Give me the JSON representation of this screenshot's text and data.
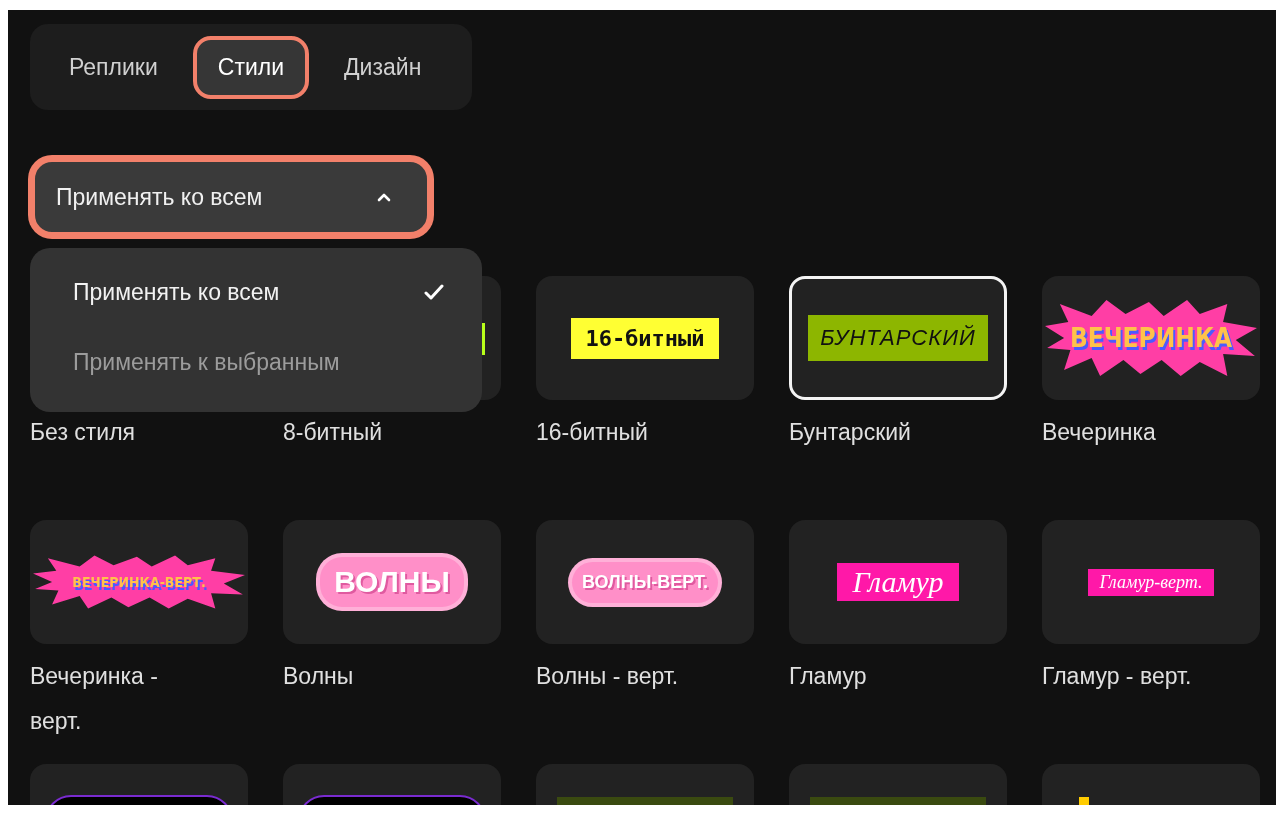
{
  "tabs": [
    {
      "label": "Реплики",
      "selected": false,
      "highlighted": false
    },
    {
      "label": "Стили",
      "selected": true,
      "highlighted": true
    },
    {
      "label": "Дизайн",
      "selected": false,
      "highlighted": false
    }
  ],
  "apply_dropdown": {
    "value": "Применять ко всем",
    "expanded": true,
    "highlighted": true,
    "options": [
      {
        "label": "Применять ко всем",
        "selected": true
      },
      {
        "label": "Применять к выбранным",
        "selected": false
      }
    ]
  },
  "styles": [
    {
      "label": "Без стиля",
      "preview": {
        "kind": "none"
      }
    },
    {
      "label": "8-битный",
      "selected": false,
      "preview": {
        "kind": "bar-edge"
      }
    },
    {
      "label": "16-битный",
      "selected": false,
      "preview": {
        "kind": "pixel",
        "text": "16-битный"
      }
    },
    {
      "label": "Бунтарский",
      "selected": true,
      "preview": {
        "kind": "grunge",
        "text": "БУНТАРСКИЙ"
      }
    },
    {
      "label": "Вечеринка",
      "selected": false,
      "preview": {
        "kind": "party",
        "text": "ВЕЧЕРИНКА",
        "small": false
      }
    },
    {
      "label": "Вечеринка - верт.",
      "selected": false,
      "preview": {
        "kind": "party",
        "text": "ВЕЧЕРИНКА-ВЕРТ.",
        "small": true
      }
    },
    {
      "label": "Волны",
      "selected": false,
      "preview": {
        "kind": "bubble",
        "text": "ВОЛНЫ",
        "small": false
      }
    },
    {
      "label": "Волны - верт.",
      "selected": false,
      "preview": {
        "kind": "bubble",
        "text": "ВОЛНЫ-ВЕРТ.",
        "small": true
      }
    },
    {
      "label": "Гламур",
      "selected": false,
      "preview": {
        "kind": "glamour",
        "text": "Гламур",
        "small": false
      }
    },
    {
      "label": "Гламур - верт.",
      "selected": false,
      "preview": {
        "kind": "glamour",
        "text": "Гламур-верт.",
        "small": true
      }
    },
    {
      "selected": false,
      "preview": {
        "kind": "dark-frame"
      }
    },
    {
      "selected": false,
      "preview": {
        "kind": "dark-frame"
      }
    },
    {
      "selected": false,
      "preview": {
        "kind": "glow-bar"
      }
    },
    {
      "selected": false,
      "preview": {
        "kind": "glow-bar"
      }
    },
    {
      "selected": false,
      "preview": {
        "kind": "yellow-mark"
      }
    }
  ]
}
